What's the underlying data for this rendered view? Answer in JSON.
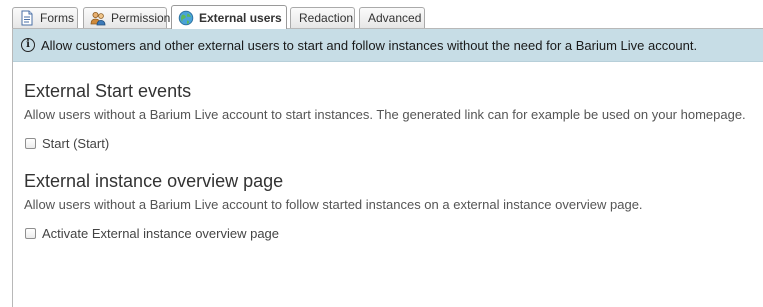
{
  "tabs": [
    {
      "label": "Forms",
      "icon": "document-icon"
    },
    {
      "label": "Permission",
      "icon": "users-icon"
    },
    {
      "label": "External users",
      "icon": "globe-icon",
      "active": true
    },
    {
      "label": "Redaction"
    },
    {
      "label": "Advanced"
    }
  ],
  "info": {
    "text": "Allow customers and other external users to start and follow instances without the need for a Barium Live account.",
    "icon": "info-icon"
  },
  "start_events": {
    "title": "External Start events",
    "description": "Allow users without a Barium Live account to start instances. The generated link can for example be used on your homepage.",
    "checkbox_label": "Start (Start)",
    "checked": false
  },
  "overview": {
    "title": "External instance overview page",
    "description": "Allow users without a Barium Live account to follow started instances on a external instance overview page.",
    "checkbox_label": "Activate External instance overview page",
    "checked": false
  },
  "colors": {
    "banner_bg": "#c7dde6",
    "heading": "#333333"
  }
}
